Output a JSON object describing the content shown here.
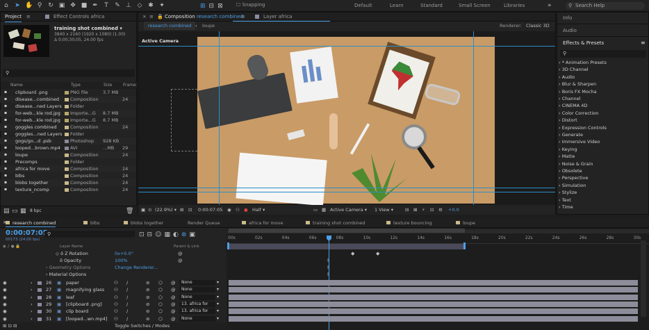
{
  "toolbar": {
    "snapping": "Snapping",
    "workspaces": [
      "Default",
      "Learn",
      "Standard",
      "Small Screen",
      "Libraries"
    ],
    "search_placeholder": "Search Help"
  },
  "project_panel": {
    "tab": "Project",
    "effect_controls": "Effect Controls africa",
    "item_name": "training shot combined",
    "item_dims": "3840 x 2160 (1920 x 1080) (1.00)",
    "item_duration": "Δ 0;00;30;05, 24.00 fps",
    "headers": {
      "name": "Name",
      "type": "Type",
      "size": "Size",
      "frame": "Frame"
    },
    "rows": [
      {
        "name": "clipboard .png",
        "type": "PNG file",
        "size": "3.7 MB",
        "frame": "",
        "color": "#b7a76a"
      },
      {
        "name": "disease...combined",
        "type": "Composition",
        "size": "",
        "frame": "24",
        "color": "#c9b98a"
      },
      {
        "name": "disease...ned Layers",
        "type": "Folder",
        "size": "",
        "frame": "",
        "color": "#c9b98a"
      },
      {
        "name": "for-web...kle rod.jpg",
        "type": "Importe...G",
        "size": "8.7 MB",
        "frame": "",
        "color": "#b7a76a"
      },
      {
        "name": "for-web...kle rod.jpg",
        "type": "Importe...G",
        "size": "8.7 MB",
        "frame": "",
        "color": "#b7a76a"
      },
      {
        "name": "goggles combined",
        "type": "Composition",
        "size": "",
        "frame": "24",
        "color": "#c9b98a"
      },
      {
        "name": "goggles...ned Layers",
        "type": "Folder",
        "size": "",
        "frame": "",
        "color": "#c9b98a"
      },
      {
        "name": "gogs/go...d .psb",
        "type": "Photoshop",
        "size": "928 KB",
        "frame": "",
        "color": "#8a8a9a"
      },
      {
        "name": "looped...brown.mp4",
        "type": "AVI",
        "size": "...MB",
        "frame": "29",
        "color": "#8a8a9a"
      },
      {
        "name": "loupe",
        "type": "Composition",
        "size": "",
        "frame": "24",
        "color": "#c9b98a"
      },
      {
        "name": "Precomps",
        "type": "Folder",
        "size": "",
        "frame": "",
        "color": "#c9b98a"
      },
      {
        "name": "africa for move",
        "type": "Composition",
        "size": "",
        "frame": "24",
        "color": "#c9b98a"
      },
      {
        "name": "blbs",
        "type": "Composition",
        "size": "",
        "frame": "24",
        "color": "#c9b98a"
      },
      {
        "name": "blobs together",
        "type": "Composition",
        "size": "",
        "frame": "24",
        "color": "#c9b98a"
      },
      {
        "name": "texture_ncomp",
        "type": "Composition",
        "size": "",
        "frame": "24",
        "color": "#c9b98a"
      }
    ],
    "bpc": "8 bpc"
  },
  "composition_panel": {
    "tab_label": "Composition",
    "tab_name": "research combined",
    "layer_tab": "Layer africa",
    "subtabs": [
      "research combined",
      "loupe"
    ],
    "renderer_label": "Renderer:",
    "renderer_value": "Classic 3D",
    "active_camera": "Active Camera",
    "zoom": "(22.9%)",
    "timecode": "0:00:07:05",
    "resolution": "Half",
    "view": "Active Camera",
    "views": "1 View",
    "offset": "+0.0"
  },
  "right_panel": {
    "info": "Info",
    "audio": "Audio",
    "effects_title": "Effects & Presets",
    "effects": [
      "* Animation Presets",
      "3D Channel",
      "Audio",
      "Blur & Sharpen",
      "Boris FX Mocha",
      "Channel",
      "CINEMA 4D",
      "Color Correction",
      "Distort",
      "Expression Controls",
      "Generate",
      "Immersive Video",
      "Keying",
      "Matte",
      "Noise & Grain",
      "Obsolete",
      "Perspective",
      "Simulation",
      "Stylize",
      "Text",
      "Time"
    ]
  },
  "timeline": {
    "tabs": [
      {
        "label": "research combined",
        "color": "#c9b98a"
      },
      {
        "label": "blbs",
        "color": "#c9b98a"
      },
      {
        "label": "blobs together",
        "color": "#c9b98a"
      },
      {
        "label": "Render Queue",
        "color": ""
      },
      {
        "label": "africa for move",
        "color": "#c9b98a"
      },
      {
        "label": "training shot combined",
        "color": "#c9b98a"
      },
      {
        "label": "texture bouncing",
        "color": "#c9b98a"
      },
      {
        "label": "loupe",
        "color": "#c9b98a"
      }
    ],
    "timecode": "0:00:07:05",
    "frames": "00173 (24.00 fps)",
    "layer_name_header": "Layer Name",
    "parent_header": "Parent & Link",
    "props": [
      {
        "label": "Z Rotation",
        "value": "0x+0.0°"
      },
      {
        "label": "Opacity",
        "value": "100%"
      },
      {
        "label": "Geometry Options",
        "value": "Change Renderer..."
      },
      {
        "label": "Material Options",
        "value": ""
      }
    ],
    "layers": [
      {
        "num": "26",
        "name": "paper",
        "parent": "None"
      },
      {
        "num": "27",
        "name": "magnifying glass",
        "parent": "None"
      },
      {
        "num": "28",
        "name": "leaf",
        "parent": "None"
      },
      {
        "num": "29",
        "name": "[clipboard .png]",
        "parent": "13. africa for"
      },
      {
        "num": "30",
        "name": "clip board",
        "parent": "13. africa for"
      },
      {
        "num": "31",
        "name": "[looped...wn.mp4]",
        "parent": "None"
      }
    ],
    "ruler": [
      "00s",
      "02s",
      "04s",
      "06s",
      "08s",
      "10s",
      "12s",
      "14s",
      "16s",
      "18s",
      "20s",
      "22s",
      "24s",
      "26s",
      "28s",
      "30s"
    ],
    "toggle_label": "Toggle Switches / Modes"
  }
}
